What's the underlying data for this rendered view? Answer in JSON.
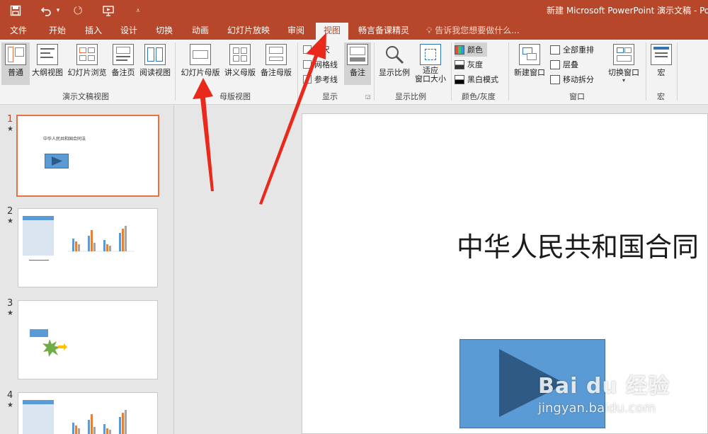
{
  "window": {
    "title": "新建 Microsoft PowerPoint 演示文稿 - Pow"
  },
  "quick_access": {
    "save_icon": "save-icon",
    "undo_icon": "undo-icon",
    "redo_icon": "redo-icon",
    "present_icon": "start-from-beginning-icon",
    "customize_icon": "customize-toolbar-icon"
  },
  "tabs": [
    {
      "label": "文件"
    },
    {
      "label": "开始"
    },
    {
      "label": "插入"
    },
    {
      "label": "设计"
    },
    {
      "label": "切换"
    },
    {
      "label": "动画"
    },
    {
      "label": "幻灯片放映"
    },
    {
      "label": "审阅"
    },
    {
      "label": "视图",
      "active": true
    },
    {
      "label": "畅言备课精灵"
    }
  ],
  "tell_me": "告诉我您想要做什么...",
  "ribbon": {
    "presentation_views": {
      "group_label": "演示文稿视图",
      "buttons": [
        "普通",
        "大纲视图",
        "幻灯片浏览",
        "备注页",
        "阅读视图"
      ]
    },
    "master_views": {
      "group_label": "母版视图",
      "buttons": [
        "幻灯片母版",
        "讲义母版",
        "备注母版"
      ]
    },
    "show": {
      "group_label": "显示",
      "items": [
        "标尺",
        "网格线",
        "参考线"
      ],
      "notes_button": "备注"
    },
    "zoom": {
      "group_label": "显示比例",
      "buttons": [
        "显示比例",
        "适应\n窗口大小"
      ]
    },
    "color": {
      "group_label": "颜色/灰度",
      "items": [
        "颜色",
        "灰度",
        "黑白模式"
      ]
    },
    "window": {
      "group_label": "窗口",
      "new_window": "新建窗口",
      "items": [
        "全部重排",
        "层叠",
        "移动拆分"
      ],
      "switch_window": "切换窗口"
    },
    "macros": {
      "group_label": "宏",
      "button": "宏"
    }
  },
  "thumbnails": [
    {
      "number": "1",
      "star": "★",
      "title": "中华人民共和国合同法",
      "selected": true
    },
    {
      "number": "2",
      "star": "★",
      "title": "",
      "selected": false
    },
    {
      "number": "3",
      "star": "★",
      "title": "",
      "selected": false
    },
    {
      "number": "4",
      "star": "★",
      "title": "",
      "selected": false
    }
  ],
  "slide": {
    "title": "中华人民共和国合同"
  },
  "watermark": {
    "brand": "Bai du 经验",
    "url": "jingyan.baidu.com"
  },
  "colors": {
    "accent": "#b7472a",
    "ribbon_bg": "#f3f3f3",
    "selection_border": "#e97040",
    "shape_blue": "#5b9bd5",
    "arrow_red": "#e8291c"
  }
}
